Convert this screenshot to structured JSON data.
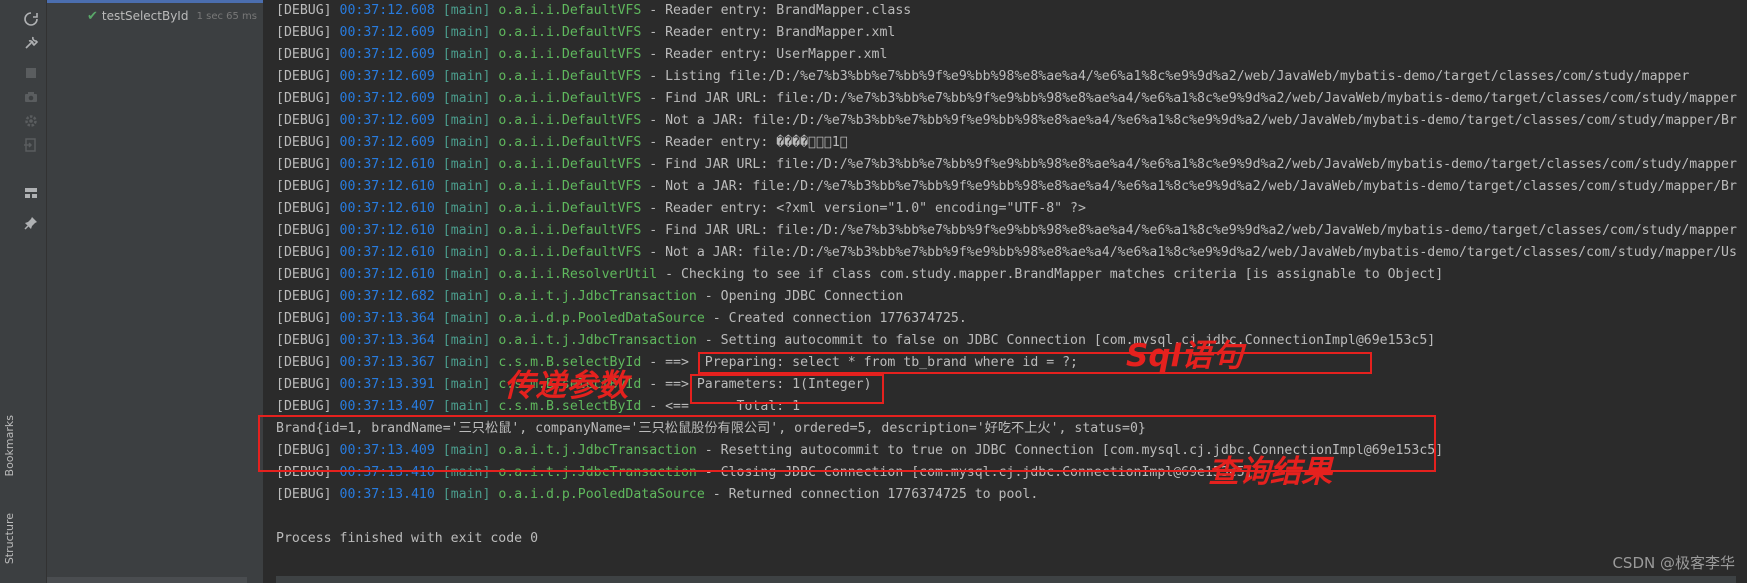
{
  "toolbar": {
    "icons": [
      "rerun-icon",
      "wrench-icon",
      "stop-icon",
      "camera-icon",
      "gear-icon",
      "exit-icon",
      "layout-icon",
      "pin-icon"
    ]
  },
  "side_tabs": {
    "bookmarks": "Bookmarks",
    "structure": "Structure"
  },
  "test_tree": {
    "item": {
      "name": "testSelectById",
      "time": "1 sec 65 ms",
      "status": "passed"
    }
  },
  "console": {
    "lines": [
      {
        "level": "[DEBUG]",
        "time": "00:37:12.608",
        "thread": "[main]",
        "logger": "o.a.i.i.DefaultVFS",
        "message": " - Reader entry: BrandMapper.class"
      },
      {
        "level": "[DEBUG]",
        "time": "00:37:12.609",
        "thread": "[main]",
        "logger": "o.a.i.i.DefaultVFS",
        "message": " - Reader entry: BrandMapper.xml"
      },
      {
        "level": "[DEBUG]",
        "time": "00:37:12.609",
        "thread": "[main]",
        "logger": "o.a.i.i.DefaultVFS",
        "message": " - Reader entry: UserMapper.xml"
      },
      {
        "level": "[DEBUG]",
        "time": "00:37:12.609",
        "thread": "[main]",
        "logger": "o.a.i.i.DefaultVFS",
        "message": " - Listing file:/D:/%e7%b3%bb%e7%bb%9f%e9%bb%98%e8%ae%a4/%e6%a1%8c%e9%9d%a2/web/JavaWeb/mybatis-demo/target/classes/com/study/mapper"
      },
      {
        "level": "[DEBUG]",
        "time": "00:37:12.609",
        "thread": "[main]",
        "logger": "o.a.i.i.DefaultVFS",
        "message": " - Find JAR URL: file:/D:/%e7%b3%bb%e7%bb%9f%e9%bb%98%e8%ae%a4/%e6%a1%8c%e9%9d%a2/web/JavaWeb/mybatis-demo/target/classes/com/study/mapper"
      },
      {
        "level": "[DEBUG]",
        "time": "00:37:12.609",
        "thread": "[main]",
        "logger": "o.a.i.i.DefaultVFS",
        "message": " - Not a JAR: file:/D:/%e7%b3%bb%e7%bb%9f%e9%bb%98%e8%ae%a4/%e6%a1%8c%e9%9d%a2/web/JavaWeb/mybatis-demo/target/classes/com/study/mapper/Br"
      },
      {
        "level": "[DEBUG]",
        "time": "00:37:12.609",
        "thread": "[main]",
        "logger": "o.a.i.i.DefaultVFS",
        "message": " - Reader entry: ����\u0000\u0000\u00001\u0000"
      },
      {
        "level": "[DEBUG]",
        "time": "00:37:12.610",
        "thread": "[main]",
        "logger": "o.a.i.i.DefaultVFS",
        "message": " - Find JAR URL: file:/D:/%e7%b3%bb%e7%bb%9f%e9%bb%98%e8%ae%a4/%e6%a1%8c%e9%9d%a2/web/JavaWeb/mybatis-demo/target/classes/com/study/mapper"
      },
      {
        "level": "[DEBUG]",
        "time": "00:37:12.610",
        "thread": "[main]",
        "logger": "o.a.i.i.DefaultVFS",
        "message": " - Not a JAR: file:/D:/%e7%b3%bb%e7%bb%9f%e9%bb%98%e8%ae%a4/%e6%a1%8c%e9%9d%a2/web/JavaWeb/mybatis-demo/target/classes/com/study/mapper/Br"
      },
      {
        "level": "[DEBUG]",
        "time": "00:37:12.610",
        "thread": "[main]",
        "logger": "o.a.i.i.DefaultVFS",
        "message": " - Reader entry: <?xml version=\"1.0\" encoding=\"UTF-8\" ?>"
      },
      {
        "level": "[DEBUG]",
        "time": "00:37:12.610",
        "thread": "[main]",
        "logger": "o.a.i.i.DefaultVFS",
        "message": " - Find JAR URL: file:/D:/%e7%b3%bb%e7%bb%9f%e9%bb%98%e8%ae%a4/%e6%a1%8c%e9%9d%a2/web/JavaWeb/mybatis-demo/target/classes/com/study/mapper"
      },
      {
        "level": "[DEBUG]",
        "time": "00:37:12.610",
        "thread": "[main]",
        "logger": "o.a.i.i.DefaultVFS",
        "message": " - Not a JAR: file:/D:/%e7%b3%bb%e7%bb%9f%e9%bb%98%e8%ae%a4/%e6%a1%8c%e9%9d%a2/web/JavaWeb/mybatis-demo/target/classes/com/study/mapper/Us"
      },
      {
        "level": "[DEBUG]",
        "time": "00:37:12.610",
        "thread": "[main]",
        "logger": "o.a.i.i.ResolverUtil",
        "message": " - Checking to see if class com.study.mapper.BrandMapper matches criteria [is assignable to Object]"
      },
      {
        "level": "[DEBUG]",
        "time": "00:37:12.682",
        "thread": "[main]",
        "logger": "o.a.i.t.j.JdbcTransaction",
        "message": " - Opening JDBC Connection"
      },
      {
        "level": "[DEBUG]",
        "time": "00:37:13.364",
        "thread": "[main]",
        "logger": "o.a.i.d.p.PooledDataSource",
        "message": " - Created connection 1776374725."
      },
      {
        "level": "[DEBUG]",
        "time": "00:37:13.364",
        "thread": "[main]",
        "logger": "o.a.i.t.j.JdbcTransaction",
        "message": " - Setting autocommit to false on JDBC Connection [com.mysql.cj.jdbc.ConnectionImpl@69e153c5]"
      },
      {
        "level": "[DEBUG]",
        "time": "00:37:13.367",
        "thread": "[main]",
        "logger": "c.s.m.B.selectById",
        "message": " - ==>  Preparing: select * from tb_brand where id = ?;"
      },
      {
        "level": "[DEBUG]",
        "time": "00:37:13.391",
        "thread": "[main]",
        "logger": "c.s.m.B.selectById",
        "message": " - ==> Parameters: 1(Integer)"
      },
      {
        "level": "[DEBUG]",
        "time": "00:37:13.407",
        "thread": "[main]",
        "logger": "c.s.m.B.selectById",
        "message": " - <==      Total: 1"
      },
      {
        "level": "",
        "time": "",
        "thread": "",
        "logger": "",
        "message": "Brand{id=1, brandName='三只松鼠', companyName='三只松鼠股份有限公司', ordered=5, description='好吃不上火', status=0}"
      },
      {
        "level": "[DEBUG]",
        "time": "00:37:13.409",
        "thread": "[main]",
        "logger": "o.a.i.t.j.JdbcTransaction",
        "message": " - Resetting autocommit to true on JDBC Connection [com.mysql.cj.jdbc.ConnectionImpl@69e153c5]"
      },
      {
        "level": "[DEBUG]",
        "time": "00:37:13.410",
        "thread": "[main]",
        "logger": "o.a.i.t.j.JdbcTransaction",
        "message": " - Closing JDBC Connection [com.mysql.cj.jdbc.ConnectionImpl@69e153c5]"
      },
      {
        "level": "[DEBUG]",
        "time": "00:37:13.410",
        "thread": "[main]",
        "logger": "o.a.i.d.p.PooledDataSource",
        "message": " - Returned connection 1776374725 to pool."
      },
      {
        "level": "",
        "time": "",
        "thread": "",
        "logger": "",
        "message": ""
      },
      {
        "level": "",
        "time": "",
        "thread": "",
        "logger": "",
        "message": "Process finished with exit code 0"
      }
    ]
  },
  "annotations": {
    "sql": "Sql语句",
    "params": "传递参数",
    "result": "查询结果",
    "color": "#e5211e"
  },
  "watermark": "CSDN @极客李华",
  "colors": {
    "timestamp": "#287bde",
    "thread": "#4b9c8c",
    "logger": "#5fb85d",
    "text": "#bbbbbb",
    "background": "#2b2b2b"
  }
}
